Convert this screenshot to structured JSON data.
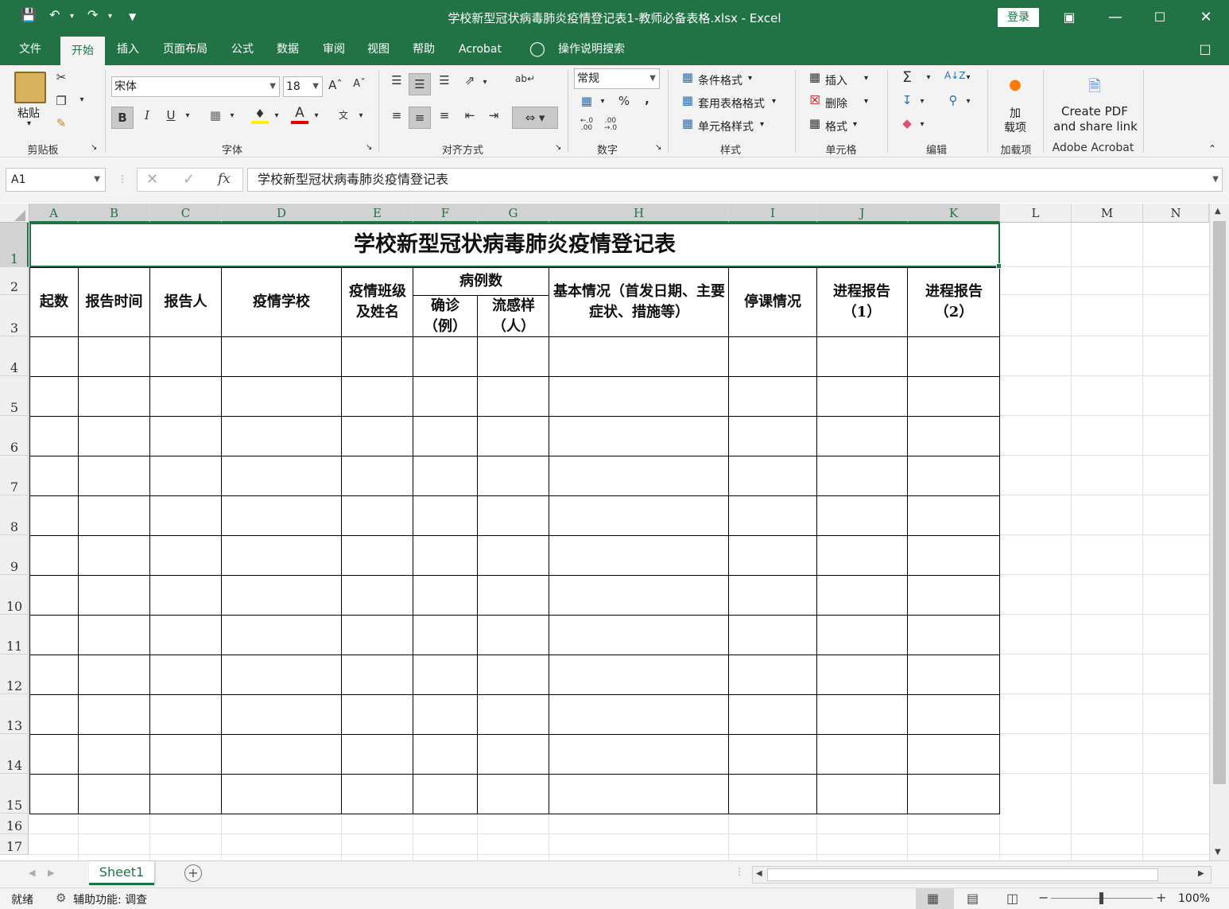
{
  "window": {
    "title": "学校新型冠状病毒肺炎疫情登记表1-教师必备表格.xlsx  -  Excel",
    "login": "登录"
  },
  "tabs": [
    "文件",
    "开始",
    "插入",
    "页面布局",
    "公式",
    "数据",
    "审阅",
    "视图",
    "帮助",
    "Acrobat"
  ],
  "tell_me": "操作说明搜索",
  "ribbon": {
    "clipboard": {
      "paste": "粘贴",
      "label": "剪贴板"
    },
    "font": {
      "name": "宋体",
      "size": "18",
      "label": "字体",
      "bold": "B",
      "italic": "I",
      "underline": "U"
    },
    "alignment": {
      "label": "对齐方式"
    },
    "number": {
      "format": "常规",
      "label": "数字",
      "percent": "%",
      "comma": ","
    },
    "styles": {
      "conditional": "条件格式",
      "table": "套用表格格式",
      "cell": "单元格样式",
      "label": "样式"
    },
    "cells": {
      "insert": "插入",
      "delete": "删除",
      "format": "格式",
      "label": "单元格"
    },
    "editing": {
      "label": "编辑"
    },
    "addins": {
      "line1": "加",
      "line2": "载项",
      "label": "加载项"
    },
    "acrobat": {
      "line1": "Create PDF",
      "line2": "and share link",
      "label": "Adobe Acrobat"
    }
  },
  "formula_bar": {
    "namebox": "A1",
    "fx": "fx",
    "value": "学校新型冠状病毒肺炎疫情登记表"
  },
  "columns": [
    "A",
    "B",
    "C",
    "D",
    "E",
    "F",
    "G",
    "H",
    "I",
    "J",
    "K",
    "L",
    "M",
    "N"
  ],
  "rows": [
    "1",
    "2",
    "3",
    "4",
    "5",
    "6",
    "7",
    "8",
    "9",
    "10",
    "11",
    "12",
    "13",
    "14",
    "15",
    "16",
    "17"
  ],
  "table": {
    "title": "学校新型冠状病毒肺炎疫情登记表",
    "h_qishu": "起数",
    "h_time": "报告时间",
    "h_reporter": "报告人",
    "h_school": "疫情学校",
    "h_class": "疫情班级及姓名",
    "h_cases": "病例数",
    "h_confirmed": "确诊（例）",
    "h_flu": "流感样（人）",
    "h_basic": "基本情况（首发日期、主要症状、措施等）",
    "h_suspend": "停课情况",
    "h_prog1": "进程报告（1）",
    "h_prog2": "进程报告（2）"
  },
  "sheet_tab": "Sheet1",
  "status": {
    "ready": "就绪",
    "accessibility": "辅助功能: 调查",
    "zoom": "100%"
  }
}
